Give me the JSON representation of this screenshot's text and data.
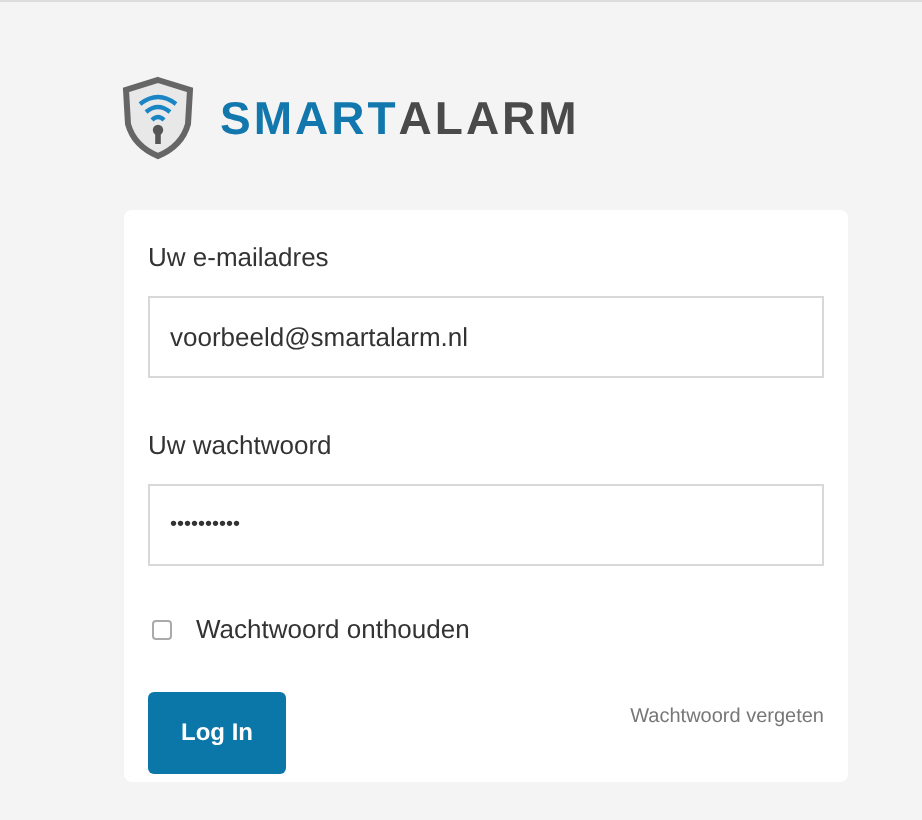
{
  "logo": {
    "parts": [
      {
        "text": "SMART",
        "color": "#1277ad"
      },
      {
        "text": "ALARM",
        "color": "#4a4a4a"
      }
    ]
  },
  "form": {
    "email": {
      "label": "Uw e-mailadres",
      "value": "voorbeeld@smartalarm.nl"
    },
    "password": {
      "label": "Uw wachtwoord",
      "value": "••••••••••"
    },
    "remember": {
      "label": "Wachtwoord onthouden",
      "checked": false
    },
    "submit": "Log In",
    "forgot": "Wachtwoord vergeten"
  }
}
